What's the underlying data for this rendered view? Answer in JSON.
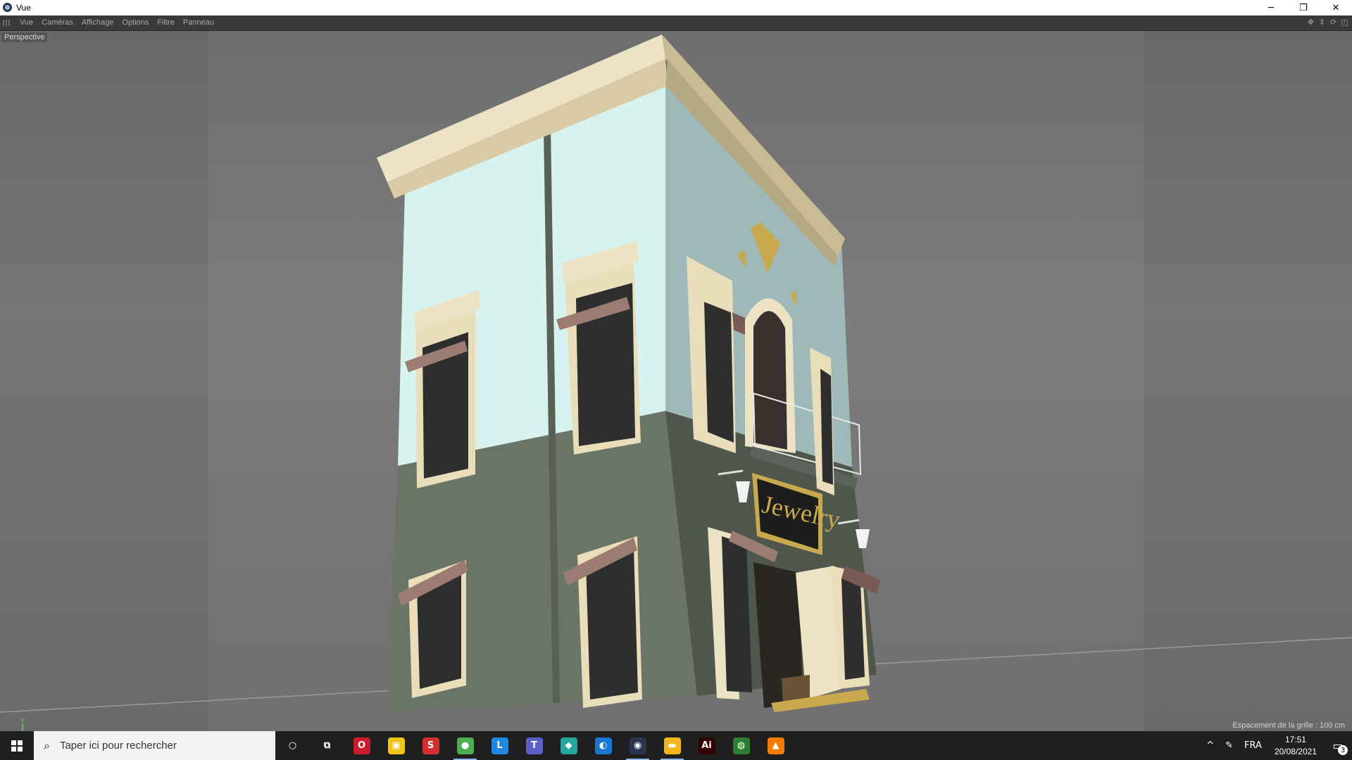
{
  "window": {
    "title": "Vue"
  },
  "window_controls": {
    "minimize": "─",
    "restore": "❐",
    "close": "✕"
  },
  "menu": {
    "items": [
      "Vue",
      "Caméras",
      "Affichage",
      "Options",
      "Filtre",
      "Panneau"
    ]
  },
  "viewport": {
    "camera_label": "Perspective",
    "grid_info": "Espacement de la grille : 100 cm",
    "sign_text": "Jewelry",
    "axis_label": "Y"
  },
  "taskbar": {
    "search_placeholder": "Taper ici pour rechercher",
    "apps": [
      {
        "name": "cortana-icon",
        "glyph": "○",
        "color": "transparent"
      },
      {
        "name": "task-view-icon",
        "glyph": "⧉",
        "color": "transparent"
      },
      {
        "name": "opera-icon",
        "glyph": "O",
        "color": "#cc1b2b"
      },
      {
        "name": "store-icon",
        "glyph": "▣",
        "color": "#f0c419"
      },
      {
        "name": "app-s-icon",
        "glyph": "S",
        "color": "#d32f2f"
      },
      {
        "name": "chrome-icon",
        "glyph": "●",
        "color": "#4caf50"
      },
      {
        "name": "app-l-icon",
        "glyph": "L",
        "color": "#1e88e5"
      },
      {
        "name": "teams-icon",
        "glyph": "T",
        "color": "#5b5fc7"
      },
      {
        "name": "app-green-icon",
        "glyph": "◆",
        "color": "#26a69a"
      },
      {
        "name": "app-blue-icon",
        "glyph": "◐",
        "color": "#1976d2"
      },
      {
        "name": "cinema4d-icon",
        "glyph": "◉",
        "color": "#2a3550"
      },
      {
        "name": "file-explorer-icon",
        "glyph": "▬",
        "color": "#f2b61a"
      },
      {
        "name": "illustrator-icon",
        "glyph": "Ai",
        "color": "#330000"
      },
      {
        "name": "globe-app-icon",
        "glyph": "◍",
        "color": "#2e7d32"
      },
      {
        "name": "vlc-icon",
        "glyph": "▲",
        "color": "#f57c00"
      }
    ],
    "tray": {
      "chevron": "^",
      "pen": "✎",
      "language": "FRA",
      "time": "17:51",
      "date": "20/08/2021",
      "notifications": "3"
    }
  }
}
